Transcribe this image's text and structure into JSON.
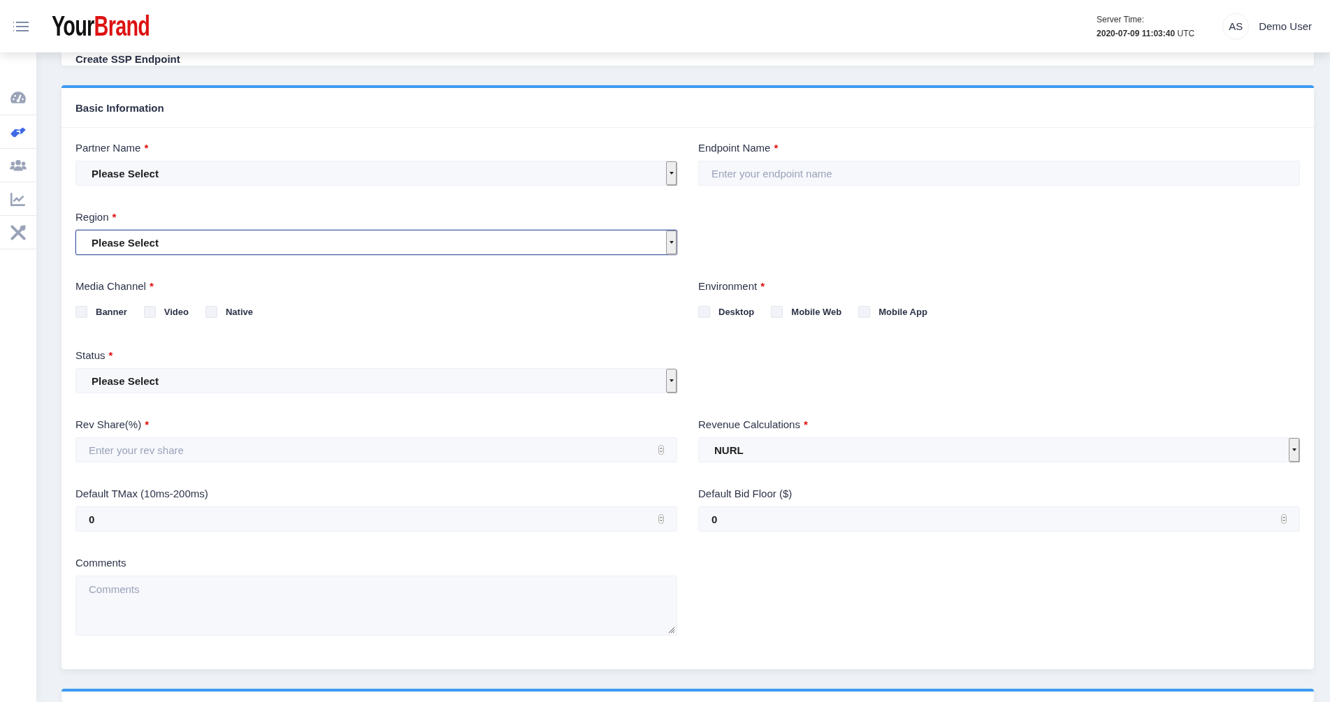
{
  "header": {
    "brand_first": "Your",
    "brand_second": "Brand",
    "server_time_label": "Server Time:",
    "server_time": "2020-07-09 11:03:40",
    "server_time_zone": "UTC",
    "avatar": "AS",
    "user_name": "Demo User"
  },
  "sidebar": {
    "items": [
      {
        "selected": false
      },
      {
        "selected": true
      },
      {
        "selected": false
      },
      {
        "selected": false
      },
      {
        "selected": false
      }
    ]
  },
  "page_title": "Create SSP Endpoint",
  "section": {
    "title": "Basic Information",
    "rows": [
      [
        {
          "kind": "select",
          "label": "Partner Name",
          "required_mark": "*",
          "focused": false,
          "value": "Please Select"
        },
        {
          "kind": "text",
          "label": "Endpoint Name",
          "required_mark": "*",
          "placeholder": "Enter your endpoint name"
        }
      ],
      [
        {
          "kind": "select",
          "label": "Region",
          "required_mark": "*",
          "focused": true,
          "value": "Please Select"
        }
      ],
      [
        {
          "kind": "checkboxes",
          "label": "Media Channel",
          "required_mark": "*",
          "options": [
            {
              "label": "Banner",
              "checked": false
            },
            {
              "label": "Video",
              "checked": false
            },
            {
              "label": "Native",
              "checked": false
            }
          ]
        },
        {
          "kind": "checkboxes",
          "label": "Environment",
          "required_mark": "*",
          "options": [
            {
              "label": "Desktop",
              "checked": false
            },
            {
              "label": "Mobile Web",
              "checked": false
            },
            {
              "label": "Mobile App",
              "checked": false
            }
          ]
        }
      ],
      [
        {
          "kind": "select",
          "label": "Status",
          "required_mark": "*",
          "focused": false,
          "value": "Please Select"
        }
      ],
      [
        {
          "kind": "number",
          "label": "Rev Share(%)",
          "required_mark": "*",
          "placeholder": "Enter your rev share"
        },
        {
          "kind": "select",
          "label": "Revenue Calculations",
          "required_mark": "*",
          "focused": false,
          "value": "NURL"
        }
      ],
      [
        {
          "kind": "number",
          "label": "Default TMax (10ms-200ms)",
          "value": "0"
        },
        {
          "kind": "number",
          "label": "Default Bid Floor ($)",
          "value": "0"
        }
      ],
      [
        {
          "kind": "textarea",
          "label": "Comments",
          "placeholder": "Comments"
        }
      ]
    ]
  }
}
